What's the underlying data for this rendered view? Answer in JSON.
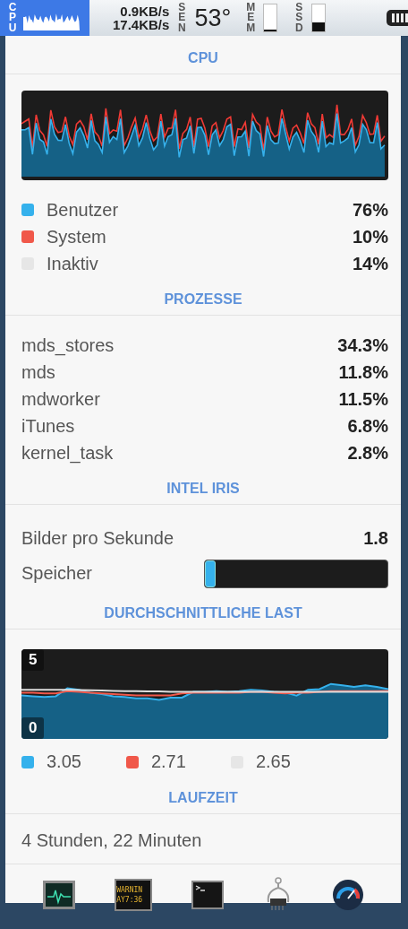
{
  "menu_bar": {
    "cpu_label": "CPU",
    "upload": "0.9KB/s",
    "download": "17.4KB/s",
    "sensor_label": "SEN",
    "temperature": "53°",
    "memory_label": "MEM",
    "memory": {
      "level": 0.05
    },
    "disk_label": "SSD",
    "disk": {
      "level": 0.35
    }
  },
  "cpu": {
    "title": "CPU",
    "legend": [
      {
        "label": "Benutzer",
        "value": "76%",
        "color": "#35b1ec"
      },
      {
        "label": "System",
        "value": "10%",
        "color": "#f0584a"
      },
      {
        "label": "Inaktiv",
        "value": "14%",
        "color": "#e6e6e6"
      }
    ]
  },
  "processes": {
    "title": "PROZESSE",
    "rows": [
      {
        "name": "mds_stores",
        "value": "34.3%"
      },
      {
        "name": "mds",
        "value": "11.8%"
      },
      {
        "name": "mdworker",
        "value": "11.5%"
      },
      {
        "name": "iTunes",
        "value": "6.8%"
      },
      {
        "name": "kernel_task",
        "value": "2.8%"
      }
    ]
  },
  "gpu": {
    "title": "INTEL IRIS",
    "rows": [
      {
        "kind": "value",
        "label": "Bilder pro Sekunde",
        "value": "1.8"
      },
      {
        "kind": "bar",
        "label": "Speicher",
        "level": 0.06
      }
    ]
  },
  "load": {
    "title": "DURCHSCHNITTLICHE LAST",
    "scale_max": "5",
    "scale_min": "0",
    "legend": [
      {
        "value": "3.05",
        "color": "#35b1ec"
      },
      {
        "value": "2.71",
        "color": "#f0584a"
      },
      {
        "value": "2.65",
        "color": "#e6e6e6"
      }
    ]
  },
  "uptime": {
    "title": "LAUFZEIT",
    "text": "4 Stunden, 22 Minuten"
  },
  "dock": [
    {
      "kind": "activity"
    },
    {
      "kind": "console",
      "lines": [
        "WARNIN",
        "AY7:36"
      ]
    },
    {
      "kind": "terminal"
    },
    {
      "kind": "system-info"
    },
    {
      "kind": "gauge"
    }
  ]
}
